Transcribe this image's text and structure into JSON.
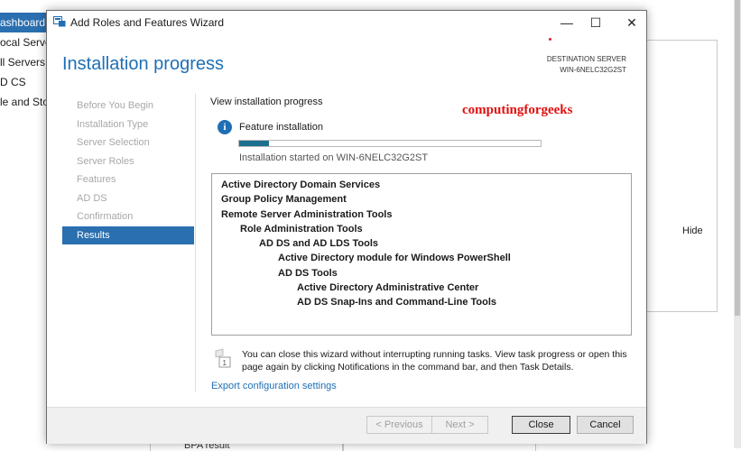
{
  "background": {
    "nav_items": [
      {
        "label": "ashboard",
        "active": true
      },
      {
        "label": "ocal Server",
        "active": false
      },
      {
        "label": "ll Servers",
        "active": false
      },
      {
        "label": "D CS",
        "active": false
      },
      {
        "label": "le and Sto",
        "active": false
      }
    ],
    "hide_label": "Hide",
    "bottom_fragment": "BPA result"
  },
  "wizard": {
    "title": "Add Roles and Features Wizard",
    "window_controls": {
      "minimize": "—",
      "maximize": "☐",
      "close": "✕"
    },
    "page_title": "Installation progress",
    "destination": {
      "label": "DESTINATION SERVER",
      "server": "WIN-6NELC32G2ST"
    },
    "steps": [
      {
        "label": "Before You Begin",
        "active": false
      },
      {
        "label": "Installation Type",
        "active": false
      },
      {
        "label": "Server Selection",
        "active": false
      },
      {
        "label": "Server Roles",
        "active": false
      },
      {
        "label": "Features",
        "active": false
      },
      {
        "label": "AD DS",
        "active": false
      },
      {
        "label": "Confirmation",
        "active": false
      },
      {
        "label": "Results",
        "active": true
      }
    ],
    "view_progress_label": "View installation progress",
    "watermark": "computingforgeeks",
    "feature_installation_label": "Feature installation",
    "progress_fraction": 0.1,
    "started_text": "Installation started on WIN-6NELC32G2ST",
    "results": [
      {
        "label": "Active Directory Domain Services",
        "indent": 0
      },
      {
        "label": "Group Policy Management",
        "indent": 0
      },
      {
        "label": "Remote Server Administration Tools",
        "indent": 0
      },
      {
        "label": "Role Administration Tools",
        "indent": 1
      },
      {
        "label": "AD DS and AD LDS Tools",
        "indent": 2
      },
      {
        "label": "Active Directory module for Windows PowerShell",
        "indent": 3
      },
      {
        "label": "AD DS Tools",
        "indent": 3
      },
      {
        "label": "Active Directory Administrative Center",
        "indent": 4
      },
      {
        "label": "AD DS Snap-Ins and Command-Line Tools",
        "indent": 4
      }
    ],
    "note_text": "You can close this wizard without interrupting running tasks. View task progress or open this page again by clicking Notifications in the command bar, and then Task Details.",
    "export_link": "Export configuration settings",
    "buttons": {
      "previous": "< Previous",
      "next": "Next >",
      "close": "Close",
      "cancel": "Cancel"
    },
    "accent_color": "#1f6fb5",
    "progress_color": "#1c6f8f"
  }
}
